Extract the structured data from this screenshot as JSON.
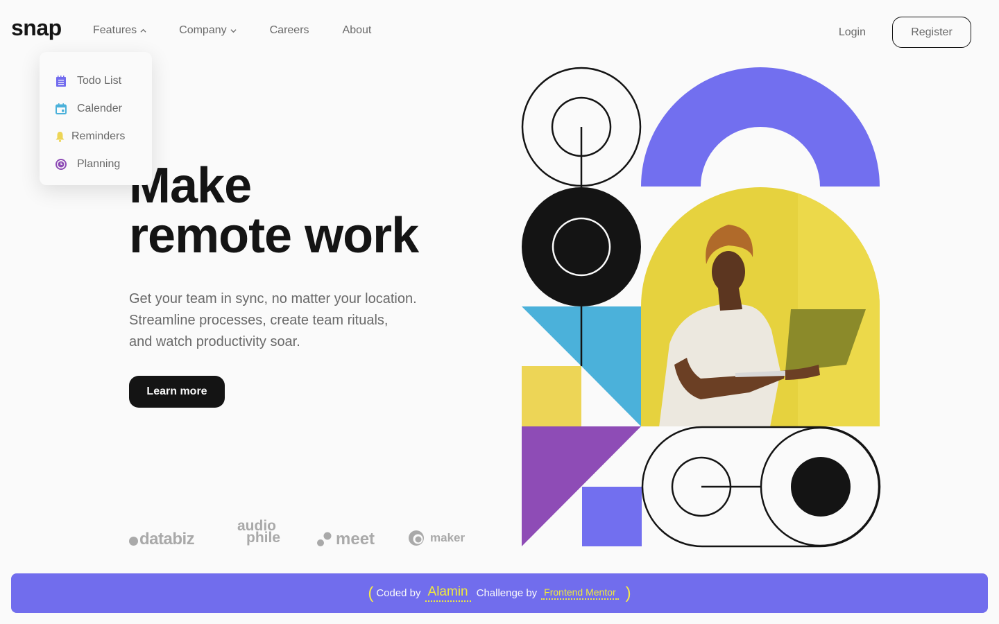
{
  "brand": {
    "logo": "snap"
  },
  "nav": {
    "items": [
      {
        "label": "Features",
        "chevron": "chevron-up-icon",
        "expanded": true
      },
      {
        "label": "Company",
        "chevron": "chevron-down-icon",
        "expanded": false
      },
      {
        "label": "Careers"
      },
      {
        "label": "About"
      }
    ],
    "login": "Login",
    "register": "Register"
  },
  "features_dropdown": {
    "items": [
      {
        "label": "Todo List",
        "icon": "todo-list-icon",
        "color": "#726cee"
      },
      {
        "label": "Calender",
        "icon": "calendar-icon",
        "color": "#4bb1da"
      },
      {
        "label": "Reminders",
        "icon": "bell-icon",
        "color": "#edd556"
      },
      {
        "label": "Planning",
        "icon": "clock-icon",
        "color": "#8e4cb6"
      }
    ]
  },
  "hero": {
    "title_lines": [
      "Make",
      "remote work"
    ],
    "text_lines": [
      "Get your team in sync, no matter your location.",
      "Streamline processes, create team rituals,",
      "and watch productivity soar."
    ],
    "cta": "Learn more"
  },
  "clients": {
    "databiz": "databiz",
    "audiophile": [
      "audio",
      "phile"
    ],
    "meet": "meet",
    "maker": "maker"
  },
  "colors": {
    "accent": "#716ded",
    "dark": "#141414",
    "gray": "#696969",
    "yellow": "#f0ea3c",
    "blue": "#4bb1da",
    "purple": "#8e4cb6",
    "illustration_yellow": "#e8d443"
  },
  "attribution": {
    "coded_by": "Coded by",
    "author": "Alamin",
    "challenge_by": "Challenge by",
    "provider": "Frontend Mentor"
  }
}
